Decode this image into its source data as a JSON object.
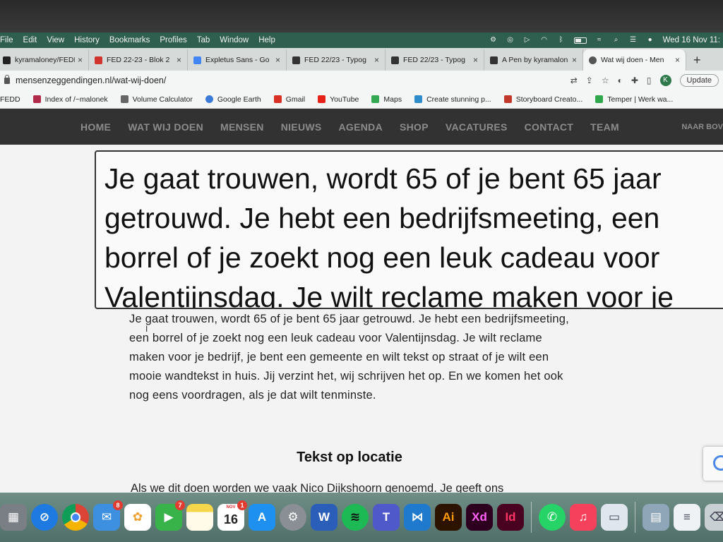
{
  "menubar": {
    "items": [
      "File",
      "Edit",
      "View",
      "History",
      "Bookmarks",
      "Profiles",
      "Tab",
      "Window",
      "Help"
    ],
    "clock": "Wed 16 Nov  11:"
  },
  "tabs": [
    {
      "label": "kyramaloney/FEDD",
      "favicon_color": "#222222"
    },
    {
      "label": "FED 22-23 - Blok 2",
      "favicon_color": "#d0342c"
    },
    {
      "label": "Expletus Sans - Go",
      "favicon_color": "#4285f4"
    },
    {
      "label": "FED 22/23 - Typog",
      "favicon_color": "#333333"
    },
    {
      "label": "FED 22/23 - Typog",
      "favicon_color": "#333333"
    },
    {
      "label": "A Pen by kyramalon",
      "favicon_color": "#333333"
    },
    {
      "label": "Wat wij doen - Men",
      "favicon_color": "#555555",
      "active": true
    }
  ],
  "address": {
    "url": "mensenzeggendingen.nl/wat-wij-doen/",
    "profile_initial": "K",
    "update_label": "Update"
  },
  "bookmarks": [
    {
      "label": "FEDD",
      "color": "#222222"
    },
    {
      "label": "Index of /~malonek",
      "color": "#b22a4a"
    },
    {
      "label": "Volume Calculator",
      "color": "#666666"
    },
    {
      "label": "Google Earth",
      "color": "#3a7ad8"
    },
    {
      "label": "Gmail",
      "color": "#d93025"
    },
    {
      "label": "YouTube",
      "color": "#e62117"
    },
    {
      "label": "Maps",
      "color": "#34a853"
    },
    {
      "label": "Create stunning p...",
      "color": "#2d8cc9"
    },
    {
      "label": "Storyboard Creato...",
      "color": "#c0392b"
    },
    {
      "label": "Temper | Werk wa...",
      "color": "#2ea84a"
    }
  ],
  "site_nav": {
    "items": [
      "HOME",
      "WAT WIJ DOEN",
      "MENSEN",
      "NIEUWS",
      "AGENDA",
      "SHOP",
      "VACATURES",
      "CONTACT",
      "TEAM"
    ],
    "right": "NAAR BOV"
  },
  "content": {
    "zoomed_text": "Je gaat trouwen, wordt 65 of je bent 65 jaar getrouwd. Je hebt een bedrijfsmeeting, een borrel of je zoekt nog een leuk cadeau voor Valentijnsdag. Je wilt reclame maken voor je",
    "body": "Je gaat trouwen, wordt 65 of je bent 65 jaar getrouwd. Je hebt een bedrijfsmeeting, een borrel of je zoekt nog een leuk cadeau voor Valentijnsdag. Je wilt reclame maken voor je bedrijf, je bent een gemeente en wilt tekst op straat of je wilt een mooie wandtekst in huis. Jij verzint het, wij schrijven het op. En we komen het ook nog eens voordragen, als je dat wilt tenminste.",
    "section_heading": "Tekst op locatie",
    "intro": "Als we dit doen worden we vaak Nico Dijkshoorn genoemd. Je geeft ons"
  },
  "dock": [
    {
      "name": "launchpad",
      "bg": "#7a7f86",
      "glyph": "▦"
    },
    {
      "name": "safari",
      "bg": "#1e7ae0",
      "glyph": "⊘"
    },
    {
      "name": "chrome",
      "bg": "#dd4b39",
      "glyph": "◉"
    },
    {
      "name": "mail",
      "bg": "#3d8fe0",
      "glyph": "✉",
      "badge": "8"
    },
    {
      "name": "photos",
      "bg": "#f0b84a",
      "glyph": "✿"
    },
    {
      "name": "facetime",
      "bg": "#37b34a",
      "glyph": "▶",
      "badge": "7"
    },
    {
      "name": "notes",
      "bg": "#f6d64a",
      "glyph": ""
    },
    {
      "name": "calendar",
      "bg": "#ffffff",
      "day": "16",
      "month": "NOV",
      "badge": "1"
    },
    {
      "name": "app-store",
      "bg": "#1e90f0",
      "glyph": "A"
    },
    {
      "name": "system-preferences",
      "bg": "#8a8f95",
      "glyph": "⚙"
    },
    {
      "name": "word",
      "bg": "#2b5eb8",
      "glyph": "W"
    },
    {
      "name": "spotify",
      "bg": "#1db954",
      "glyph": "≋"
    },
    {
      "name": "teams",
      "bg": "#5059c9",
      "glyph": "T"
    },
    {
      "name": "vscode",
      "bg": "#1f7acd",
      "glyph": "⋈"
    },
    {
      "name": "illustrator",
      "bg": "#2b1300",
      "glyph": "Ai",
      "fg": "#ff9a00"
    },
    {
      "name": "xd",
      "bg": "#2e001f",
      "glyph": "Xd",
      "fg": "#ff61f6"
    },
    {
      "name": "indesign",
      "bg": "#49021f",
      "glyph": "Id",
      "fg": "#ff3366"
    },
    {
      "name": "whatsapp",
      "bg": "#25d366",
      "glyph": "✆"
    },
    {
      "name": "music",
      "bg": "#f5415b",
      "glyph": "♫"
    },
    {
      "name": "preview",
      "bg": "#dfe6ee",
      "glyph": "▭",
      "fg": "#445"
    },
    {
      "name": "downloads",
      "bg": "#8fa6b8",
      "glyph": "▤"
    },
    {
      "name": "documents",
      "bg": "#eef2f5",
      "glyph": "≡",
      "fg": "#556"
    },
    {
      "name": "trash",
      "bg": "#c8d0d4",
      "glyph": "🗑",
      "fg": "#445"
    }
  ]
}
